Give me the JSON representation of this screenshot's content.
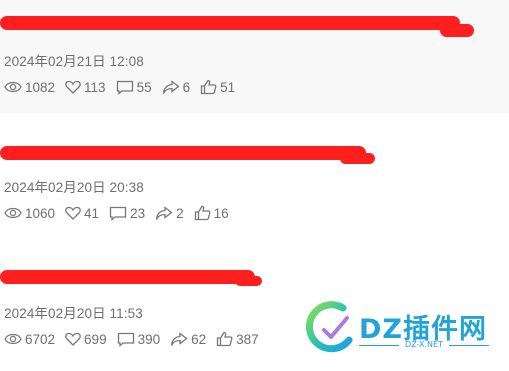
{
  "posts": [
    {
      "date": "2024年02月21日 12:08",
      "views": "1082",
      "likes": "113",
      "comments": "55",
      "shares": "6",
      "thumbs": "51"
    },
    {
      "date": "2024年02月20日 20:38",
      "views": "1060",
      "likes": "41",
      "comments": "23",
      "shares": "2",
      "thumbs": "16"
    },
    {
      "date": "2024年02月20日 11:53",
      "views": "6702",
      "likes": "699",
      "comments": "390",
      "shares": "62",
      "thumbs": "387"
    }
  ],
  "watermark": {
    "title": "DZ插件网",
    "subtitle": "DZ-X.NET"
  },
  "colors": {
    "redaction": "#ff1f1f",
    "watermark": "#23a4d9",
    "card_highlight": "#f8f8f8"
  },
  "icons": [
    "eye-icon",
    "heart-icon",
    "comment-icon",
    "share-icon",
    "thumbs-up-icon"
  ]
}
